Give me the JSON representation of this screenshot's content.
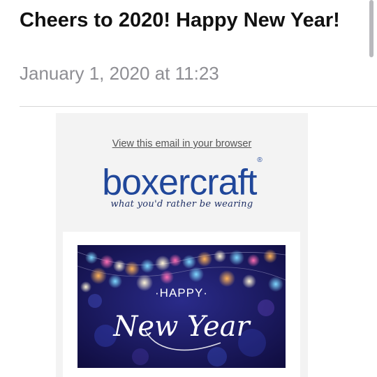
{
  "message": {
    "subject": "Cheers to 2020! Happy New Year!",
    "date": "January 1, 2020 at 11:23"
  },
  "email": {
    "view_in_browser": "View this email in your browser",
    "logo": {
      "word": "boxercraft",
      "mark": "®",
      "tagline": "what you'd rather be wearing"
    },
    "banner": {
      "happy": "·HAPPY·",
      "script": "New Year"
    }
  },
  "colors": {
    "brand_blue": "#20479a",
    "banner_bg": "#16124e"
  }
}
